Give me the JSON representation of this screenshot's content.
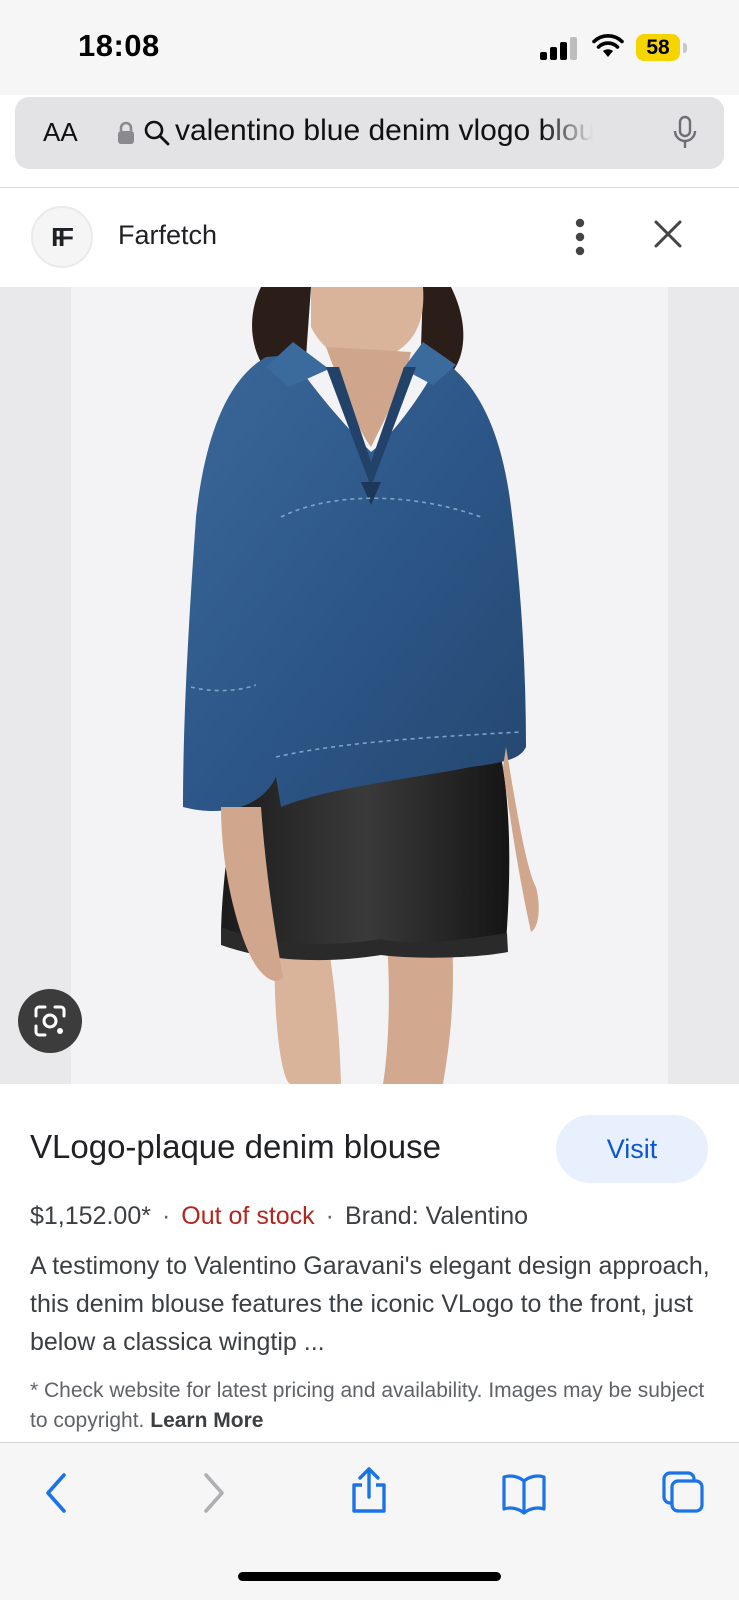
{
  "status_bar": {
    "time": "18:08",
    "battery": "58",
    "icons": [
      "cellular-signal-icon",
      "wifi-icon",
      "battery-icon"
    ]
  },
  "url_bar": {
    "text_size_label": "AA",
    "url": "valentino blue denim vlogo blouse",
    "icons": [
      "lock-icon",
      "search-icon",
      "microphone-icon"
    ]
  },
  "source": {
    "favicon_text": "FF",
    "site_name": "Farfetch",
    "icons": [
      "more-vertical-icon",
      "close-icon"
    ]
  },
  "image": {
    "description_icon": "visual-search-icon"
  },
  "product": {
    "title": "VLogo-plaque denim blouse",
    "visit_label": "Visit",
    "price": "$1,152.00*",
    "separator": "·",
    "stock_status": "Out of stock",
    "brand": "Brand: Valentino",
    "description": "A testimony to Valentino Garavani's elegant design approach, this denim blouse features the iconic VLogo to the front, just below a classica wingtip ...",
    "disclaimer": "* Check website for latest pricing and availability. Images may be subject to copyright.",
    "learn_more": "Learn More"
  },
  "toolbar": {
    "icons": [
      "back-icon",
      "forward-icon",
      "share-icon",
      "bookmarks-icon",
      "tabs-icon"
    ]
  },
  "colors": {
    "accent": "#0b57d0",
    "accent_bg": "#e8f0fe",
    "stock_red": "#b3261e",
    "denim": "#2f5b8c",
    "battery": "#f5d400",
    "safari_blue": "#1a73e8"
  }
}
